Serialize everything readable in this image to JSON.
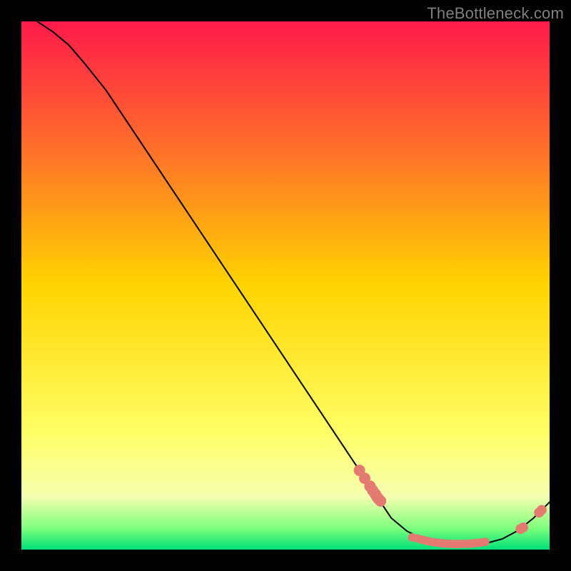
{
  "watermark": "TheBottleneck.com",
  "chart_data": {
    "type": "line",
    "title": "",
    "xlabel": "",
    "ylabel": "",
    "xlim": [
      0,
      100
    ],
    "ylim": [
      0,
      100
    ],
    "grid": false,
    "background_gradient": [
      "#ff1a4a",
      "#ff6f2a",
      "#ffd400",
      "#ffff66",
      "#f6ffb0",
      "#7cff7c",
      "#00e07a"
    ],
    "series": [
      {
        "name": "curve",
        "type": "line",
        "color": "#000000",
        "x": [
          3,
          6,
          9,
          12,
          16,
          20,
          25,
          30,
          35,
          40,
          45,
          50,
          55,
          60,
          65,
          68,
          70,
          73,
          76,
          79,
          82,
          85,
          88,
          91,
          94,
          97,
          100
        ],
        "y": [
          100,
          98,
          95.5,
          92,
          87,
          81,
          73.5,
          66,
          58.5,
          51,
          43.5,
          36,
          28.5,
          21,
          13.5,
          9,
          6,
          3.5,
          2,
          1.3,
          1,
          1,
          1.2,
          2,
          3.6,
          6,
          9
        ]
      },
      {
        "name": "descent-points",
        "type": "scatter",
        "color": "#e47a72",
        "size": 8,
        "x": [
          64,
          65,
          66,
          66.5,
          67,
          67.3,
          67.6,
          68
        ],
        "y": [
          15,
          13.5,
          12,
          11.2,
          10.5,
          10,
          9.6,
          9.2
        ]
      },
      {
        "name": "trough-points",
        "type": "scatter",
        "color": "#e47a72",
        "size": 6,
        "x": [
          74,
          75,
          75.8,
          76.5,
          77.2,
          78,
          78.8,
          79.5,
          80.2,
          81,
          81.8,
          82.5,
          83.2,
          84,
          84.8,
          85.5,
          86.2,
          87,
          87.8
        ],
        "y": [
          2.3,
          2.1,
          1.9,
          1.7,
          1.55,
          1.4,
          1.3,
          1.2,
          1.15,
          1.1,
          1.08,
          1.07,
          1.08,
          1.09,
          1.12,
          1.18,
          1.25,
          1.33,
          1.45
        ]
      },
      {
        "name": "ascent-points",
        "type": "scatter",
        "color": "#e47a72",
        "size": 7,
        "x": [
          94.5,
          95,
          98,
          98.5
        ],
        "y": [
          3.9,
          4.2,
          7,
          7.5
        ]
      }
    ]
  }
}
